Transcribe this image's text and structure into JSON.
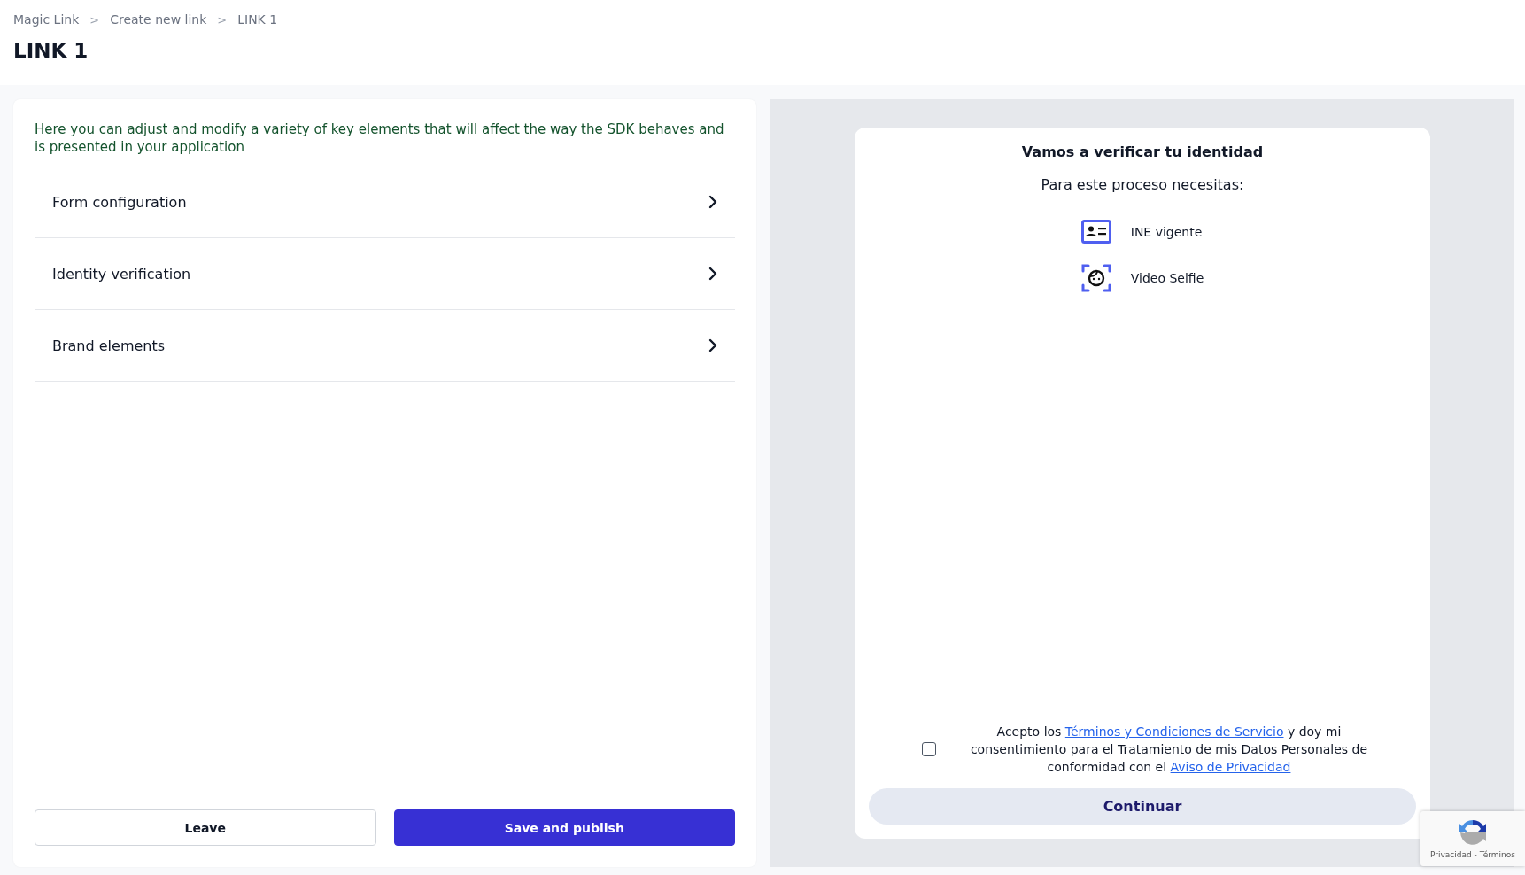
{
  "breadcrumb": [
    {
      "label": "Magic Link",
      "separator": ">"
    },
    {
      "label": "Create new link",
      "separator": ">"
    },
    {
      "label": "LINK 1"
    }
  ],
  "page_title": "LINK 1",
  "settings": {
    "description": "Here you can adjust and modify a variety of key elements that will affect the way the SDK behaves and is presented in your application",
    "sections": [
      {
        "label": "Form configuration",
        "expanded": false
      },
      {
        "label": "Identity verification",
        "expanded": false
      },
      {
        "label": "Brand elements",
        "expanded": false
      }
    ],
    "buttons": [
      {
        "label": "Leave",
        "kind": "secondary"
      },
      {
        "label": "Save and publish",
        "kind": "primary"
      }
    ]
  },
  "preview": {
    "title": "Vamos a verificar tu identidad",
    "subtitle": "Para este proceso necesitas:",
    "requirements": [
      {
        "label": "INE vigente",
        "kind": "id-card"
      },
      {
        "label": "Video Selfie",
        "kind": "selfie"
      }
    ],
    "consent": {
      "checked": false,
      "before": "Acepto los ",
      "terms_link": "Términos y Condiciones de Servicio",
      "middle": " y doy mi consentimiento para el Tratamiento de mis Datos Personales de conformidad con el ",
      "privacy_link": "Aviso de Privacidad"
    },
    "continue_button": "Continuar"
  },
  "recaptcha": {
    "footer": "Privacidad - Términos"
  }
}
